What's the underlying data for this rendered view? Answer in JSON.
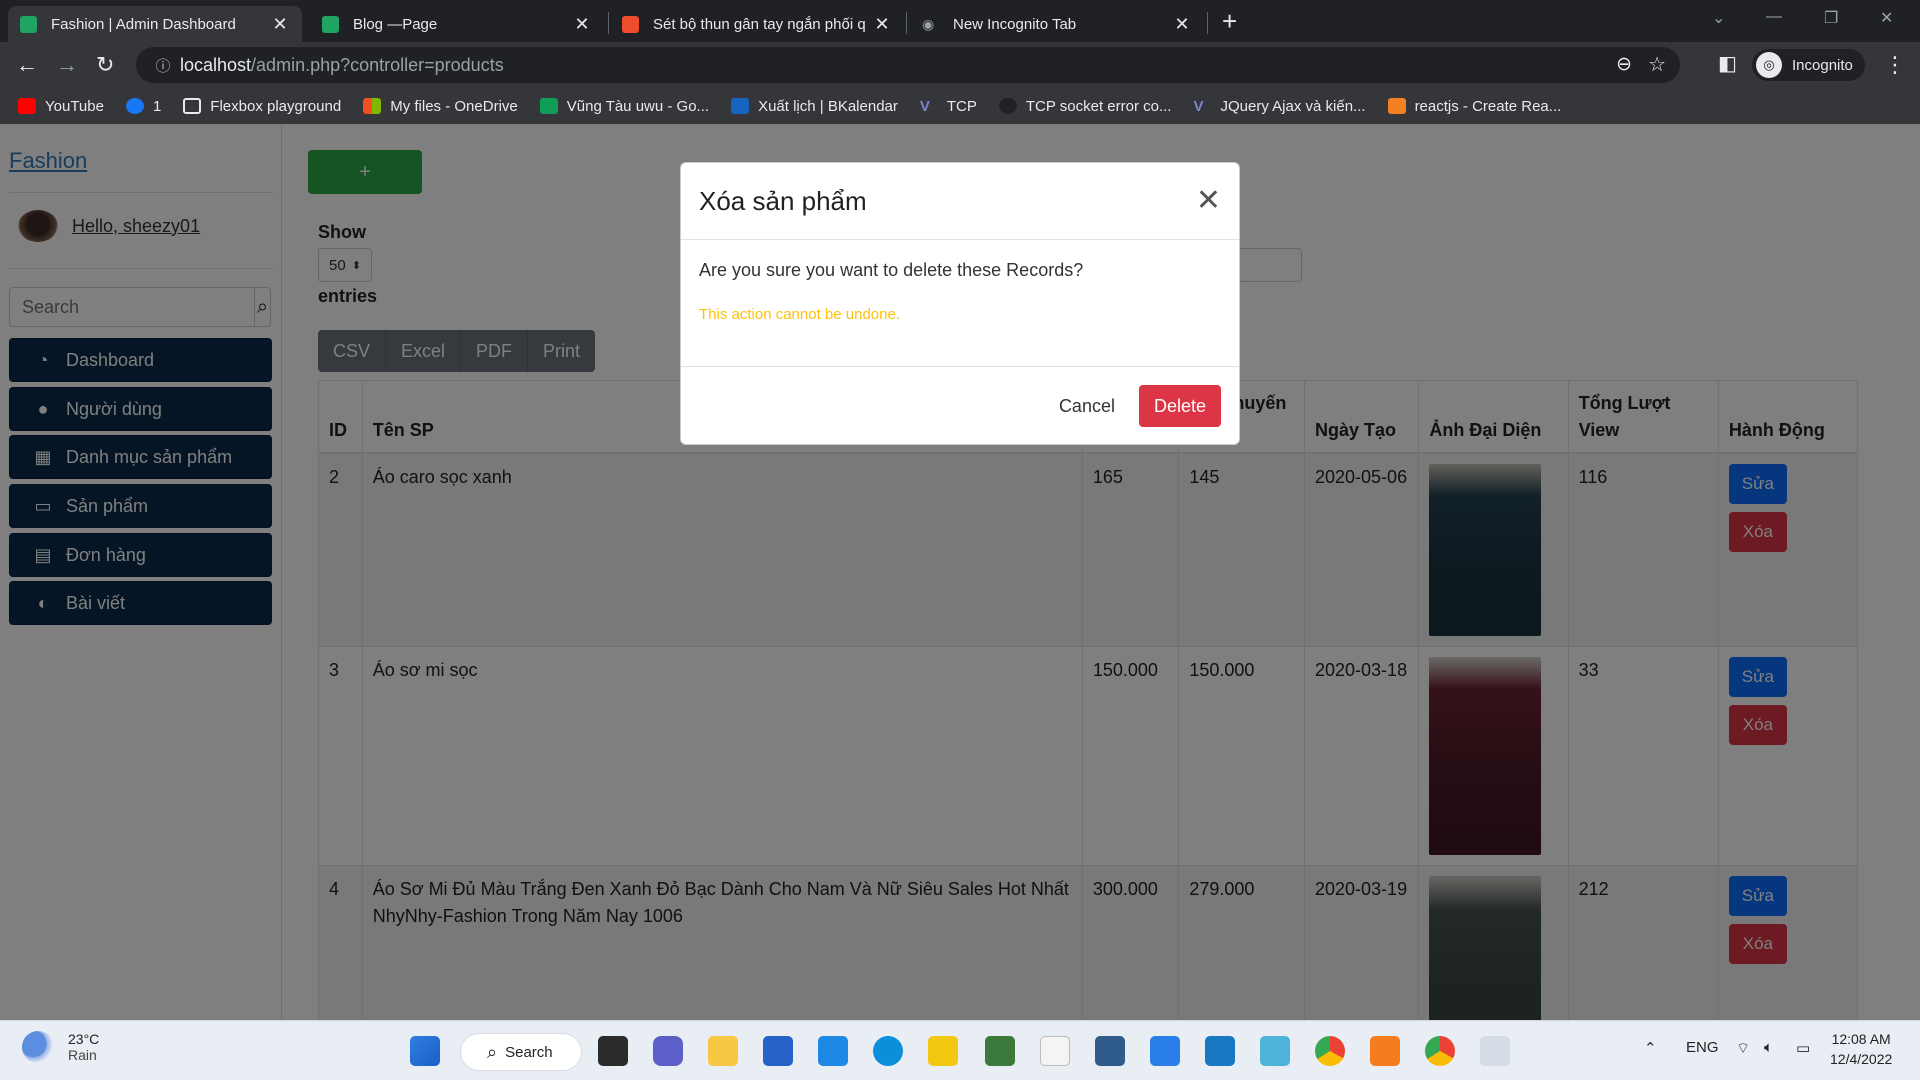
{
  "browser": {
    "tabs": [
      {
        "title": "Fashion | Admin Dashboard",
        "active": true,
        "color": "#1fa463"
      },
      {
        "title": "Blog —Page",
        "active": false,
        "color": "#1fa463"
      },
      {
        "title": "Sét bộ thun gân tay ngắn phối q",
        "active": false,
        "color": "#ee4d2d"
      },
      {
        "title": "New Incognito Tab",
        "active": false,
        "color": "#9aa0a6"
      }
    ],
    "url_host": "localhost",
    "url_path": "/admin.php?controller=products",
    "profile": "Incognito",
    "bookmarks": [
      {
        "label": "YouTube",
        "color": "#ff0000"
      },
      {
        "label": "1",
        "color": "#1877f2"
      },
      {
        "label": "Flexbox playground",
        "color": "#e8eaed"
      },
      {
        "label": "My files - OneDrive",
        "color": "#f25022"
      },
      {
        "label": "Vũng Tàu uwu - Go...",
        "color": "#0f9d58"
      },
      {
        "label": "Xuất lịch | BKalendar",
        "color": "#1565c0"
      },
      {
        "label": "TCP",
        "color": "#3f51b5"
      },
      {
        "label": "TCP socket error co...",
        "color": "#202124"
      },
      {
        "label": "JQuery Ajax và kiến...",
        "color": "#3f51b5"
      },
      {
        "label": "reactjs - Create Rea...",
        "color": "#f48024"
      }
    ]
  },
  "sidebar": {
    "brand": "Fashion",
    "greeting": "Hello, sheezy01",
    "search_placeholder": "Search",
    "items": [
      {
        "label": "Dashboard",
        "icon": "dashboard-icon"
      },
      {
        "label": "Người dùng",
        "icon": "user-icon"
      },
      {
        "label": "Danh mục sản phẩm",
        "icon": "grid-icon"
      },
      {
        "label": "Sản phẩm",
        "icon": "monitor-icon"
      },
      {
        "label": "Đơn hàng",
        "icon": "file-icon"
      },
      {
        "label": "Bài viết",
        "icon": "blog-icon"
      }
    ]
  },
  "main": {
    "add_label": "+",
    "show_label": "Show",
    "entries_value": "50",
    "entries_label": "entries",
    "export_buttons": [
      "CSV",
      "Excel",
      "PDF",
      "Print"
    ],
    "columns": [
      "ID",
      "Tên SP",
      "",
      "Giá khuyến mãi",
      "Ngày Tạo",
      "Ảnh Đại Diện",
      "Tổng Lượt View",
      "Hành Động"
    ],
    "rows": [
      {
        "id": "2",
        "name": "Áo caro sọc xanh",
        "price": "165",
        "sale": "145",
        "date": "2020-05-06",
        "views": "116",
        "img": "#1f3a4f"
      },
      {
        "id": "3",
        "name": "Áo sơ mi sọc",
        "price": "150.000",
        "sale": "150.000",
        "date": "2020-03-18",
        "views": "33",
        "img": "#5a1f2a"
      },
      {
        "id": "4",
        "name": "Áo Sơ Mi Đủ Màu Trắng Đen Xanh Đỏ Bạc Dành Cho Nam Và Nữ Siêu Sales Hot Nhất NhyNhy-Fashion Trong Năm Nay 1006",
        "price": "300.000",
        "sale": "279.000",
        "date": "2020-03-19",
        "views": "212",
        "img": "#3b4545"
      }
    ],
    "edit_label": "Sửa",
    "delete_label": "Xóa"
  },
  "modal": {
    "title": "Xóa sản phẩm",
    "message": "Are you sure you want to delete these Records?",
    "warning": "This action cannot be undone.",
    "cancel": "Cancel",
    "confirm": "Delete"
  },
  "taskbar": {
    "temperature": "23°C",
    "weather": "Rain",
    "search": "Search",
    "lang": "ENG",
    "time": "12:08 AM",
    "date": "12/4/2022"
  }
}
